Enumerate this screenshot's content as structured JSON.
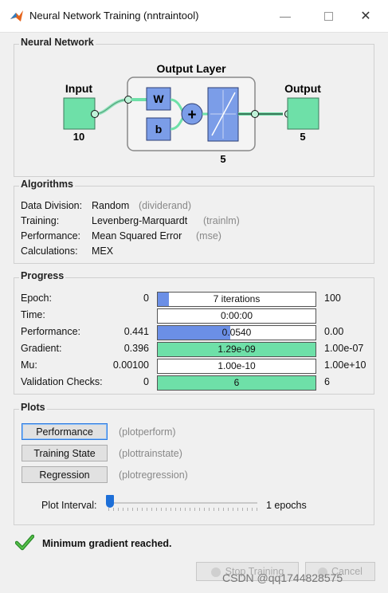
{
  "window": {
    "title": "Neural Network Training (nntraintool)"
  },
  "network": {
    "panel_title": "Neural Network",
    "input_label": "Input",
    "input_size": "10",
    "layer_label": "Output Layer",
    "weight_label": "W",
    "bias_label": "b",
    "sum_symbol": "+",
    "layer_size": "5",
    "output_label": "Output",
    "output_size": "5"
  },
  "algorithms": {
    "panel_title": "Algorithms",
    "rows": [
      {
        "label": "Data Division:",
        "value": "Random",
        "fn": "(dividerand)"
      },
      {
        "label": "Training:",
        "value": "Levenberg-Marquardt",
        "fn": "(trainlm)"
      },
      {
        "label": "Performance:",
        "value": "Mean Squared Error",
        "fn": "(mse)"
      },
      {
        "label": "Calculations:",
        "value": "MEX",
        "fn": ""
      }
    ]
  },
  "progress": {
    "panel_title": "Progress",
    "rows": [
      {
        "label": "Epoch:",
        "start": "0",
        "text": "7 iterations",
        "end": "100",
        "fill": 0.07,
        "color": "#6b8fe6"
      },
      {
        "label": "Time:",
        "start": "",
        "text": "0:00:00",
        "end": "",
        "fill": 0,
        "color": "#6b8fe6"
      },
      {
        "label": "Performance:",
        "start": "0.441",
        "text": "0.0540",
        "end": "0.00",
        "fill": 0.46,
        "color": "#6b8fe6"
      },
      {
        "label": "Gradient:",
        "start": "0.396",
        "text": "1.29e-09",
        "end": "1.00e-07",
        "fill": 1.0,
        "color": "#6ee0a8"
      },
      {
        "label": "Mu:",
        "start": "0.00100",
        "text": "1.00e-10",
        "end": "1.00e+10",
        "fill": 0,
        "color": "#6b8fe6"
      },
      {
        "label": "Validation Checks:",
        "start": "0",
        "text": "6",
        "end": "6",
        "fill": 1.0,
        "color": "#6ee0a8"
      }
    ]
  },
  "plots": {
    "panel_title": "Plots",
    "buttons": [
      {
        "label": "Performance",
        "fn": "(plotperform)"
      },
      {
        "label": "Training State",
        "fn": "(plottrainstate)"
      },
      {
        "label": "Regression",
        "fn": "(plotregression)"
      }
    ],
    "interval_label": "Plot Interval:",
    "interval_value": "1 epochs",
    "interval_level": 0
  },
  "status": {
    "message": "Minimum gradient reached."
  },
  "footer": {
    "stop_label": "Stop Training",
    "cancel_label": "Cancel",
    "watermark": "CSDN @qq1744828575"
  },
  "colors": {
    "accent_green": "#6ee0a8",
    "accent_blue": "#6b8fe6",
    "layer_blue": "#7b9de8"
  }
}
